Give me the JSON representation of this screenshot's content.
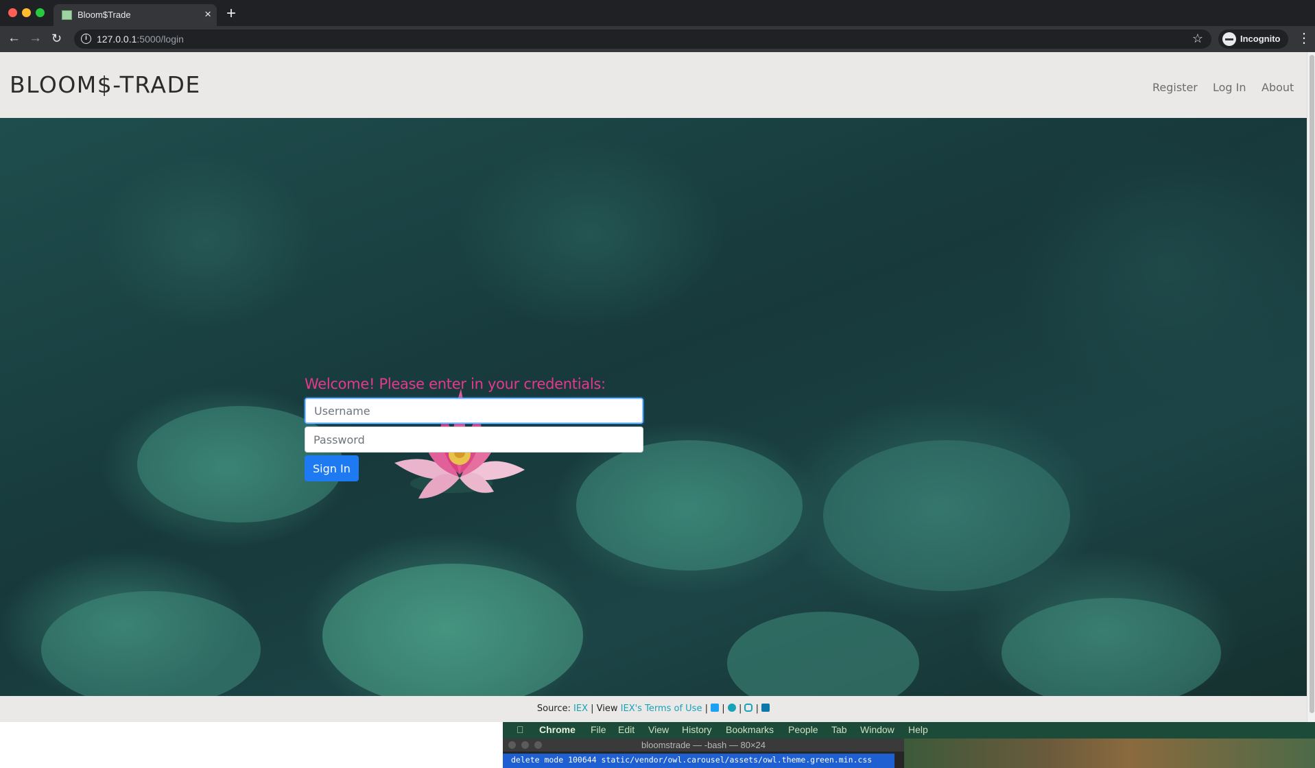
{
  "browser": {
    "tab_title": "Bloom$Trade",
    "url_host": "127.0.0.1",
    "url_rest": ":5000/login",
    "incognito_label": "Incognito"
  },
  "site": {
    "brand": "BLOOM$-TRADE",
    "nav": [
      "Register",
      "Log In",
      "About"
    ]
  },
  "login": {
    "heading": "Welcome! Please enter in your credentials:",
    "username_placeholder": "Username",
    "password_placeholder": "Password",
    "submit_label": "Sign In"
  },
  "footer": {
    "source_label": "Source:",
    "source_link": "IEX",
    "view_label": "| View",
    "terms_link": "IEX's Terms of Use",
    "sep": "|",
    "social_icons": [
      "twitter-icon",
      "facebook-icon",
      "instagram-icon",
      "linkedin-icon"
    ]
  },
  "mac_menubar": {
    "app": "Chrome",
    "items": [
      "File",
      "Edit",
      "View",
      "History",
      "Bookmarks",
      "People",
      "Tab",
      "Window",
      "Help"
    ]
  },
  "terminal": {
    "title": "bloomstrade — -bash — 80×24",
    "line": "delete mode 100644 static/vendor/owl.carousel/assets/owl.theme.green.min.css"
  },
  "colors": {
    "heading_pink": "#e8378e",
    "button_blue": "#1d7af3",
    "link_teal": "#17a2b8",
    "header_bg": "#eae9e8"
  }
}
